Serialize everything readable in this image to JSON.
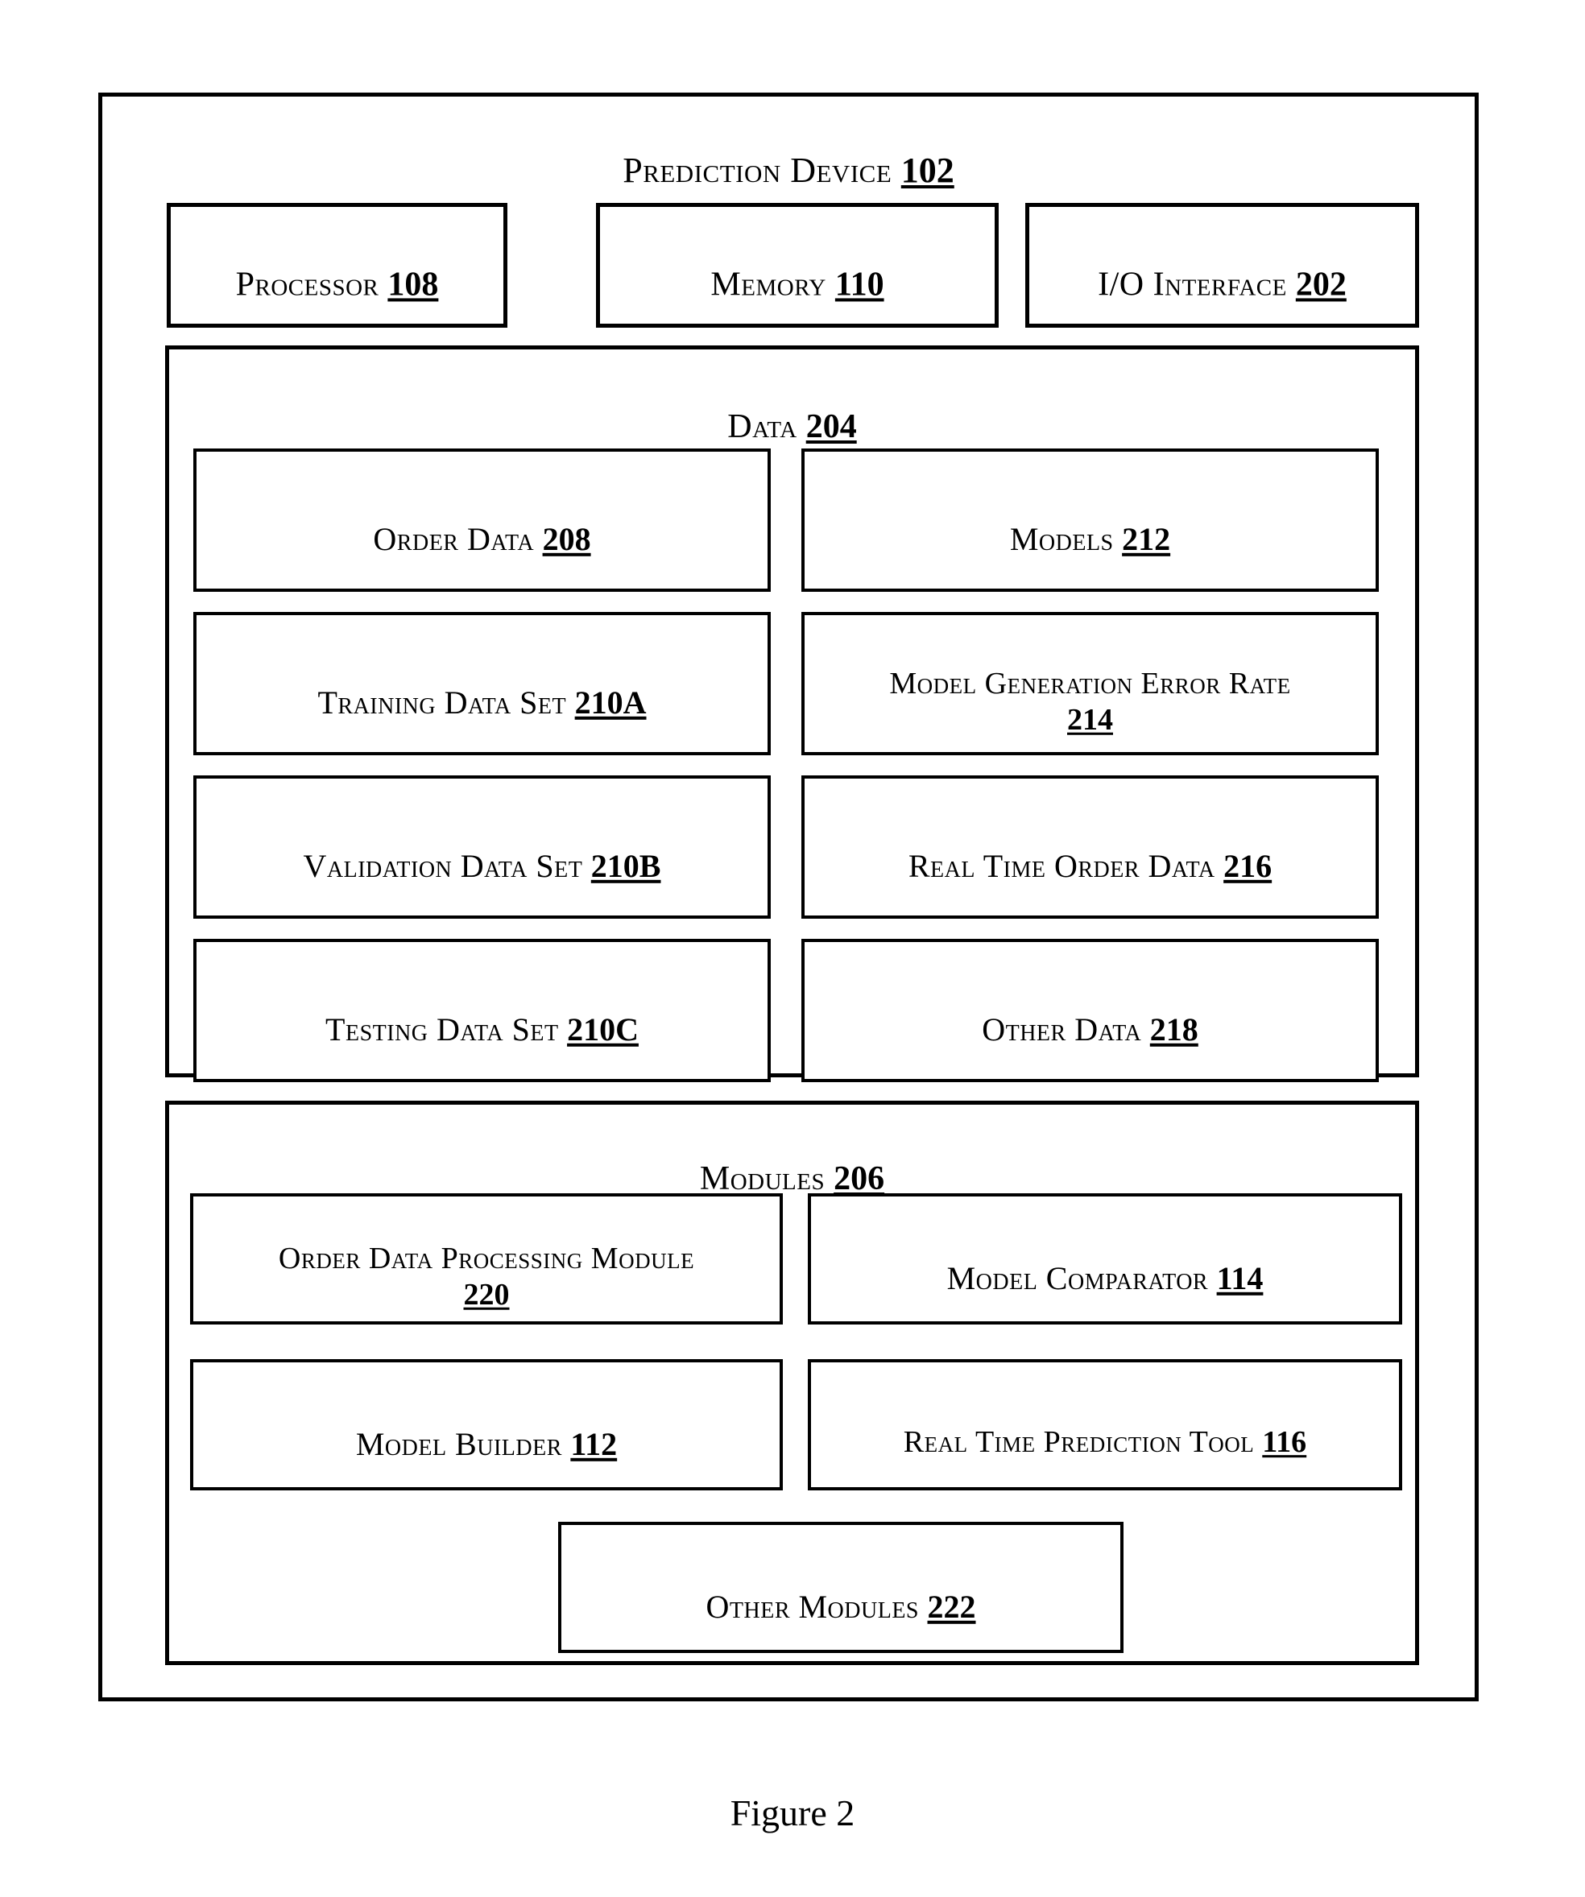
{
  "figure": {
    "caption": "Figure 2"
  },
  "device": {
    "title_text": "Prediction Device",
    "title_ref": "102"
  },
  "top_row": [
    {
      "name": "processor",
      "text": "Processor",
      "ref": "108"
    },
    {
      "name": "memory",
      "text": "Memory",
      "ref": "110"
    },
    {
      "name": "io-interface",
      "text": "I/O Interface",
      "ref": "202"
    }
  ],
  "data_panel": {
    "title_text": "Data",
    "title_ref": "204",
    "left_column": [
      {
        "name": "order-data",
        "text": "Order Data",
        "ref": "208",
        "wrap": false
      },
      {
        "name": "training-data-set",
        "text": "Training Data Set",
        "ref": "210A",
        "wrap": false
      },
      {
        "name": "validation-data-set",
        "text": "Validation Data Set",
        "ref": "210B",
        "wrap": false
      },
      {
        "name": "testing-data-set",
        "text": "Testing Data Set",
        "ref": "210C",
        "wrap": false
      }
    ],
    "right_column": [
      {
        "name": "models",
        "text": "Models",
        "ref": "212",
        "wrap": false
      },
      {
        "name": "model-generation-error-rate",
        "text": "Model Generation Error Rate",
        "ref": "214",
        "wrap": true
      },
      {
        "name": "real-time-order-data",
        "text": "Real Time Order Data",
        "ref": "216",
        "wrap": false
      },
      {
        "name": "other-data",
        "text": "Other Data",
        "ref": "218",
        "wrap": false
      }
    ]
  },
  "modules_panel": {
    "title_text": "Modules",
    "title_ref": "206",
    "left_column": [
      {
        "name": "order-data-processing-module",
        "text": "Order Data Processing Module",
        "ref": "220",
        "wrap": true
      },
      {
        "name": "model-builder",
        "text": "Model Builder",
        "ref": "112",
        "wrap": false
      }
    ],
    "right_column": [
      {
        "name": "model-comparator",
        "text": "Model Comparator",
        "ref": "114",
        "wrap": false
      },
      {
        "name": "real-time-prediction-tool",
        "text": "Real Time Prediction Tool",
        "ref": "116",
        "wrap": false
      }
    ],
    "bottom": [
      {
        "name": "other-modules",
        "text": "Other Modules",
        "ref": "222",
        "wrap": false
      }
    ]
  },
  "colors": {
    "stroke": "#000000",
    "background": "#ffffff",
    "text": "#000000"
  }
}
